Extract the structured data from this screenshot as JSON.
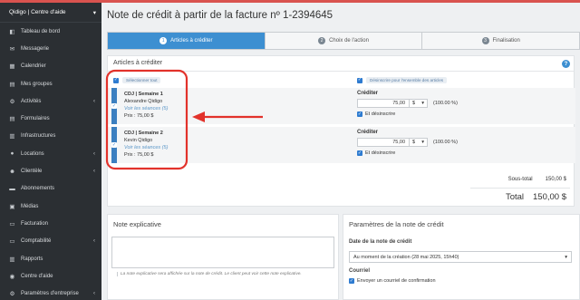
{
  "sidebar": {
    "org": "Qidigo | Centre d'aide",
    "items": [
      {
        "label": "Tableau de bord",
        "icon": "dashboard-icon",
        "glyph": "◧"
      },
      {
        "label": "Messagerie",
        "icon": "mail-icon",
        "glyph": "✉"
      },
      {
        "label": "Calendrier",
        "icon": "calendar-icon",
        "glyph": "▦"
      },
      {
        "label": "Mes groupes",
        "icon": "groups-icon",
        "glyph": "▤"
      },
      {
        "label": "Activités",
        "icon": "gear-icon",
        "glyph": "⚙"
      },
      {
        "label": "Formulaires",
        "icon": "forms-icon",
        "glyph": "▤"
      },
      {
        "label": "Infrastructures",
        "icon": "building-icon",
        "glyph": "▥"
      },
      {
        "label": "Locations",
        "icon": "location-pin-icon",
        "glyph": "●"
      },
      {
        "label": "Clientèle",
        "icon": "users-icon",
        "glyph": "☻"
      },
      {
        "label": "Abonnements",
        "icon": "subscription-icon",
        "glyph": "▬"
      },
      {
        "label": "Médias",
        "icon": "media-icon",
        "glyph": "▣"
      },
      {
        "label": "Facturation",
        "icon": "billing-icon",
        "glyph": "▭"
      },
      {
        "label": "Comptabilité",
        "icon": "accounting-icon",
        "glyph": "▭"
      },
      {
        "label": "Rapports",
        "icon": "reports-icon",
        "glyph": "▥"
      },
      {
        "label": "Centre d'aide",
        "icon": "help-icon",
        "glyph": "◉"
      },
      {
        "label": "Paramètres d'entreprise",
        "icon": "settings-icon",
        "glyph": "⚙"
      }
    ]
  },
  "page": {
    "title": "Note de crédit à partir de la facture nº 1-2394645"
  },
  "steps": [
    {
      "num": "1",
      "label": "Articles à créditer"
    },
    {
      "num": "2",
      "label": "Choix de l'action"
    },
    {
      "num": "3",
      "label": "Finalisation"
    }
  ],
  "articles": {
    "title": "Articles à créditer",
    "select_all": "Sélectionner tout",
    "unsubscribe_all": "Désinscrire pour l'ensemble des articles",
    "credit_label": "Créditer",
    "unsub_label": "Et désinscrire",
    "items": [
      {
        "title": "CDJ | Semaine 1",
        "name": "Alexandre Qidigo",
        "link": "Voir les séances (5)",
        "price": "Prix : 75,00 $",
        "amount": "75,00",
        "unit": "$",
        "pct": "(100.00 %)"
      },
      {
        "title": "CDJ | Semaine 2",
        "name": "Kevin Qidigo",
        "link": "Voir les séances (5)",
        "price": "Prix : 75,00 $",
        "amount": "75,00",
        "unit": "$",
        "pct": "(100.00 %)"
      }
    ],
    "subtotal_label": "Sous-total",
    "subtotal_value": "150,00 $",
    "total_label": "Total",
    "total_value": "150,00 $"
  },
  "note": {
    "title": "Note explicative",
    "hint": "La note explicative sera affichée sur la note de crédit. Le client peut voir cette note explicative."
  },
  "params": {
    "title": "Paramètres de la note de crédit",
    "date_label": "Date de la note de crédit",
    "date_value": "Au moment de la création (28 mai 2025, 15h40)",
    "courriel_label": "Courriel",
    "confirm_label": "Envoyer un courriel de confirmation"
  },
  "colors": {
    "accent": "#3d8fd1",
    "sidebar": "#2b2f33",
    "annotation": "#e2322b",
    "topbar": "#d9534f"
  }
}
